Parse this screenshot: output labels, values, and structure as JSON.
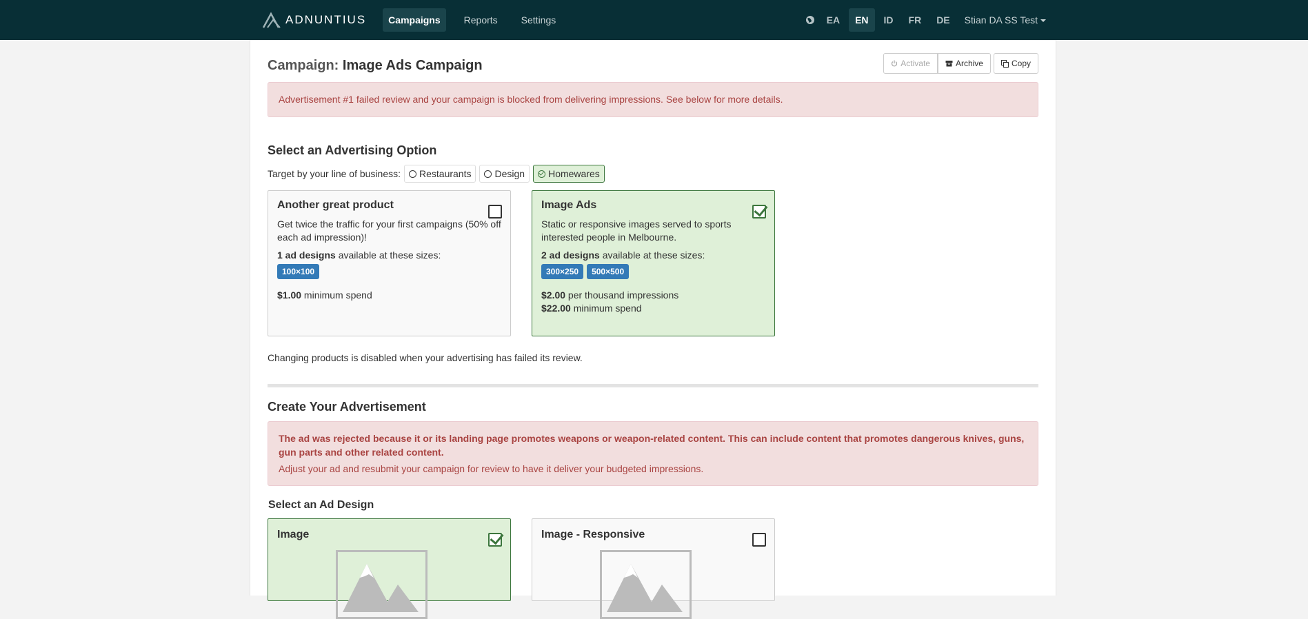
{
  "nav": {
    "brand": "ADNUNTIUS",
    "links": [
      "Campaigns",
      "Reports",
      "Settings"
    ],
    "languages": [
      "EA",
      "EN",
      "ID",
      "FR",
      "DE"
    ],
    "active_language": "EN",
    "user": "Stian DA SS Test"
  },
  "page": {
    "title_prefix": "Campaign:",
    "title": "Image Ads Campaign",
    "buttons": {
      "activate": "Activate",
      "archive": "Archive",
      "copy": "Copy"
    }
  },
  "alerts": {
    "top": "Advertisement #1 failed review and your campaign is blocked from delivering impressions. See below for more details.",
    "rejection_strong": "The ad was rejected because it or its landing page promotes weapons or weapon-related content. This can include content that promotes dangerous knives, guns, gun parts and other related content.",
    "rejection_note": "Adjust your ad and resubmit your campaign for review to have it deliver your budgeted impressions."
  },
  "advertising": {
    "heading": "Select an Advertising Option",
    "target_label": "Target by your line of business:",
    "business_options": [
      "Restaurants",
      "Design",
      "Homewares"
    ],
    "selected_business": "Homewares",
    "products": [
      {
        "title": "Another great product",
        "desc": "Get twice the traffic for your first campaigns (50% off each ad impression)!",
        "designs_count": "1 ad designs",
        "designs_suffix": " available at these sizes:",
        "sizes": [
          "100×100"
        ],
        "spend_amount": "$1.00",
        "spend_label": " minimum spend",
        "selected": false
      },
      {
        "title": "Image Ads",
        "desc": "Static or responsive images served to sports interested people in Melbourne.",
        "designs_count": "2 ad designs",
        "designs_suffix": " available at these sizes:",
        "sizes": [
          "300×250",
          "500×500"
        ],
        "cpm_amount": "$2.00",
        "cpm_label": " per thousand impressions",
        "spend_amount": "$22.00",
        "spend_label": " minimum spend",
        "selected": true
      }
    ],
    "note": "Changing products is disabled when your advertising has failed its review."
  },
  "create": {
    "heading": "Create Your Advertisement",
    "design_heading": "Select an Ad Design",
    "designs": [
      {
        "title": "Image",
        "selected": true
      },
      {
        "title": "Image - Responsive",
        "selected": false
      }
    ]
  },
  "colors": {
    "navbar": "#082f36",
    "alert_bg": "#f2dede",
    "alert_text": "#a94442",
    "selected_bg": "#dff0d8",
    "selected_border": "#3c763d",
    "badge": "#337ab7"
  }
}
